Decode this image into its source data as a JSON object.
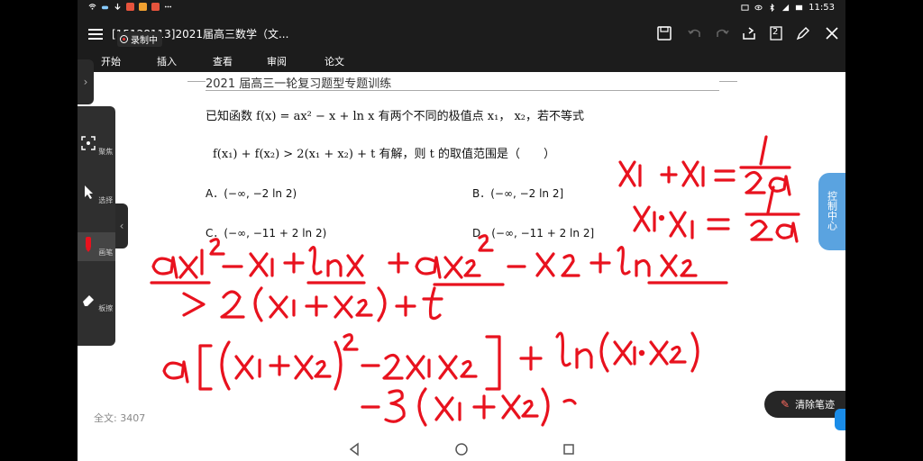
{
  "status": {
    "time": "11:53"
  },
  "app": {
    "title": "[15128113]2021届高三数学（文...",
    "recording_label": "录制中"
  },
  "toolbar": {
    "page_count": "2"
  },
  "tabs": [
    "开始",
    "插入",
    "查看",
    "审阅",
    "论文"
  ],
  "document": {
    "header": "2021 届高三一轮复习题型专题训练",
    "question_line1": "已知函数 f(x) = ax² − x + ln x 有两个不同的极值点 x₁， x₂，若不等式",
    "question_line2": "f(x₁) + f(x₂) > 2(x₁ + x₂) + t 有解，则 t 的取值范围是（　　）",
    "options": {
      "A": "A．(−∞, −2 ln 2)",
      "B": "B．(−∞, −2 ln 2]",
      "C": "C．(−∞, −11 + 2 ln 2)",
      "D": "D．(−∞, −11 + 2 ln 2]"
    },
    "word_count": "全文: 3407"
  },
  "left_panel": {
    "items": [
      "聚焦",
      "选择",
      "画笔",
      "板擦"
    ]
  },
  "control_center": "控制中心",
  "clear_ink_label": "清除笔迹",
  "colors": {
    "ink": "#e8121e",
    "accent": "#5aa3e0",
    "bar": "#1c1c1c"
  }
}
